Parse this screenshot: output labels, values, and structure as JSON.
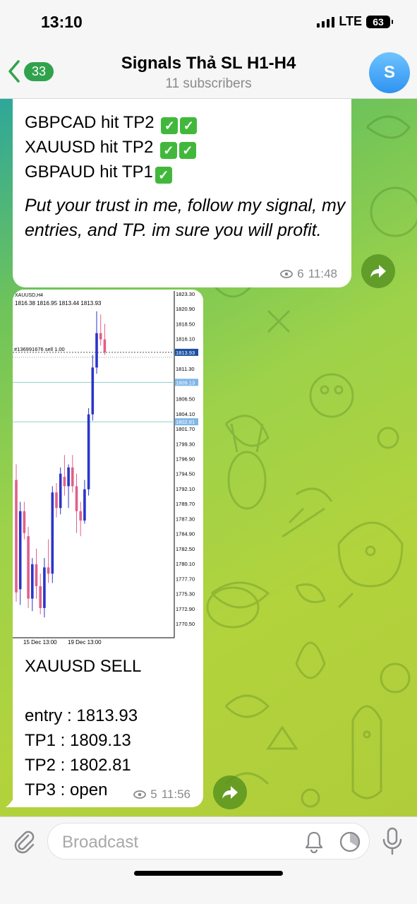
{
  "status": {
    "time": "13:10",
    "network": "LTE",
    "battery": "63"
  },
  "header": {
    "back_count": "33",
    "title": "Signals Thả SL H1-H4",
    "subtitle": "11 subscribers",
    "avatar_letter": "S"
  },
  "message1": {
    "lines": [
      "GBPCAD hit TP2",
      "XAUUSD hit TP2",
      "GBPAUD hit TP1"
    ],
    "checks": [
      "✓",
      "✓",
      "✓",
      "✓",
      "✓"
    ],
    "italic": "Put your trust in me, follow my signal, my entries, and TP. im sure you will profit.",
    "views": "6",
    "time": "11:48"
  },
  "message2": {
    "chart": {
      "symbol": "XAUUSD,H4",
      "ohlc": "1816.38 1816.95 1813.44 1813.93",
      "order": "#136991676 sell 1.00",
      "price_labels": [
        "1823.30",
        "1820.90",
        "1818.50",
        "1816.10",
        "1811.30",
        "1806.50",
        "1804.10",
        "1801.70",
        "1799.30",
        "1796.90",
        "1794.50",
        "1792.10",
        "1789.70",
        "1787.30",
        "1784.90",
        "1782.50",
        "1780.10",
        "1777.70",
        "1775.30",
        "1772.90",
        "1770.50"
      ],
      "marker_labels": [
        "1813.93",
        "1809.13",
        "1802.81"
      ],
      "dates": [
        "15 Dec 13:00",
        "19 Dec 13:00"
      ]
    },
    "chart_data": {
      "type": "candlestick",
      "title": "XAUUSD,H4",
      "x": [
        "15 Dec 13:00",
        "19 Dec 13:00"
      ],
      "ylim": [
        1770.5,
        1823.3
      ],
      "candles": [
        {
          "o": 1793.5,
          "h": 1796.0,
          "l": 1774.0,
          "c": 1775.5
        },
        {
          "o": 1776.0,
          "h": 1790.0,
          "l": 1773.5,
          "c": 1788.5
        },
        {
          "o": 1788.5,
          "h": 1790.0,
          "l": 1784.0,
          "c": 1785.0
        },
        {
          "o": 1784.5,
          "h": 1786.0,
          "l": 1773.0,
          "c": 1774.5
        },
        {
          "o": 1774.5,
          "h": 1781.0,
          "l": 1772.5,
          "c": 1780.0
        },
        {
          "o": 1780.0,
          "h": 1782.5,
          "l": 1774.5,
          "c": 1776.5
        },
        {
          "o": 1776.5,
          "h": 1778.5,
          "l": 1772.0,
          "c": 1773.0
        },
        {
          "o": 1773.0,
          "h": 1781.0,
          "l": 1771.5,
          "c": 1779.5
        },
        {
          "o": 1779.5,
          "h": 1784.0,
          "l": 1777.0,
          "c": 1778.5
        },
        {
          "o": 1778.5,
          "h": 1792.5,
          "l": 1777.0,
          "c": 1791.5
        },
        {
          "o": 1791.5,
          "h": 1793.0,
          "l": 1787.5,
          "c": 1789.0
        },
        {
          "o": 1789.0,
          "h": 1795.5,
          "l": 1788.0,
          "c": 1794.5
        },
        {
          "o": 1794.0,
          "h": 1797.5,
          "l": 1791.0,
          "c": 1792.5
        },
        {
          "o": 1792.5,
          "h": 1796.0,
          "l": 1789.0,
          "c": 1795.5
        },
        {
          "o": 1795.5,
          "h": 1797.5,
          "l": 1791.5,
          "c": 1792.5
        },
        {
          "o": 1792.5,
          "h": 1794.5,
          "l": 1785.0,
          "c": 1788.5
        },
        {
          "o": 1788.5,
          "h": 1790.0,
          "l": 1784.5,
          "c": 1787.0
        },
        {
          "o": 1787.0,
          "h": 1793.5,
          "l": 1786.5,
          "c": 1792.0
        },
        {
          "o": 1792.0,
          "h": 1805.0,
          "l": 1791.0,
          "c": 1804.0
        },
        {
          "o": 1804.0,
          "h": 1813.5,
          "l": 1803.0,
          "c": 1811.5
        },
        {
          "o": 1811.5,
          "h": 1820.5,
          "l": 1810.5,
          "c": 1817.0
        },
        {
          "o": 1817.0,
          "h": 1820.0,
          "l": 1815.0,
          "c": 1816.0
        },
        {
          "o": 1816.0,
          "h": 1818.5,
          "l": 1813.5,
          "c": 1813.9
        }
      ],
      "lines": [
        1813.93,
        1809.13,
        1802.81
      ],
      "grid": false
    },
    "lines": [
      "XAUUSD SELL",
      "entry : 1813.93",
      "TP1 : 1809.13",
      "TP2 : 1802.81",
      "TP3 : open"
    ],
    "views": "5",
    "time": "11:56"
  },
  "input": {
    "placeholder": "Broadcast"
  },
  "colors": {
    "accent": "#31a24c",
    "bull": "#2b35c9",
    "bear": "#e0608a",
    "meta": "#8a8a8e"
  },
  "icons": [
    "back-chevron-icon",
    "attach-icon",
    "bell-icon",
    "clock-icon",
    "mic-icon",
    "forward-icon",
    "eye-icon"
  ]
}
